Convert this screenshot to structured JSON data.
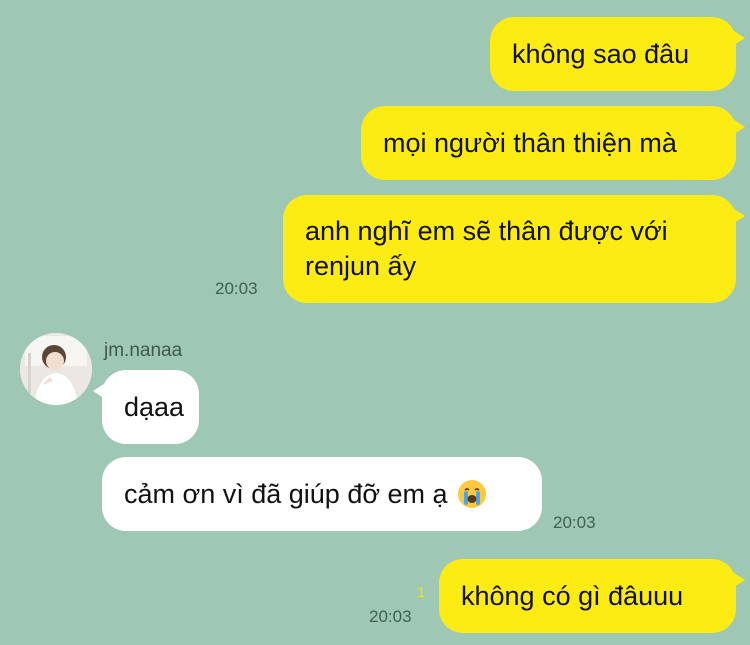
{
  "messages_out": [
    {
      "text": "không sao đâu"
    },
    {
      "text": "mọi người thân thiện mà"
    },
    {
      "lines": [
        "anh nghĩ em sẽ thân được với",
        "renjun ấy"
      ],
      "time": "20:03"
    }
  ],
  "incoming": {
    "sender": "jm.nanaa",
    "messages": [
      {
        "text": "dạaa"
      },
      {
        "text": "cảm ơn vì đã giúp đỡ em ạ",
        "emoji": "loudly-crying-face",
        "time": "20:03"
      }
    ]
  },
  "last_out": {
    "text": "không có gì đâuuu",
    "unread_count": "1",
    "time": "20:03"
  },
  "colors": {
    "background": "#9fc8b4",
    "outgoing_bubble": "#fdeb14",
    "incoming_bubble": "#ffffff"
  }
}
